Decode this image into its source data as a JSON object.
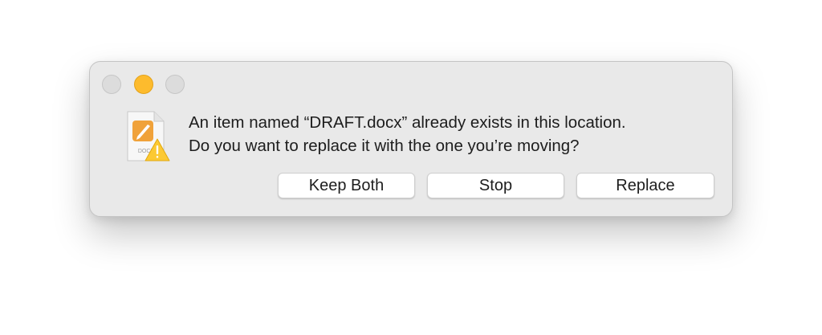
{
  "dialog": {
    "message_line1": "An item named “DRAFT.docx” already exists in this location.",
    "message_line2": "Do you want to replace it with the one you’re moving?",
    "icon_label": "DOCX",
    "icon": "document-warning-icon",
    "buttons": {
      "keep_both": "Keep Both",
      "stop": "Stop",
      "replace": "Replace"
    }
  },
  "colors": {
    "window_background": "#e9e9e9",
    "minimize_button": "#fdbb2d",
    "document_accent": "#f0a23a",
    "warning_yellow": "#fcc933"
  }
}
